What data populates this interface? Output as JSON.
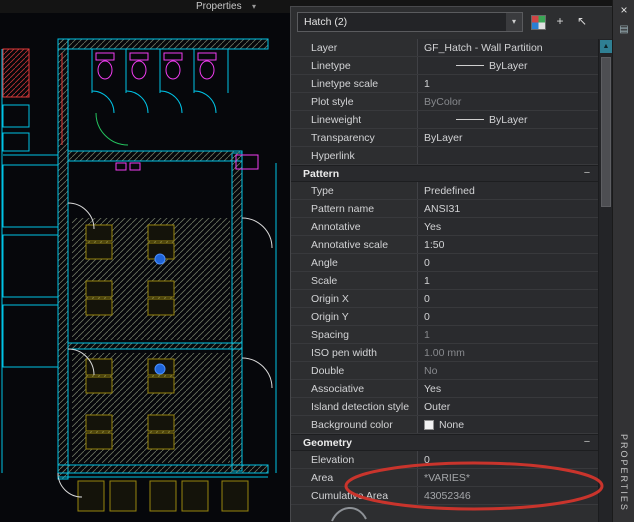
{
  "topbar": {
    "title": "Properties",
    "caret": "▾"
  },
  "panel": {
    "selector": {
      "value": "Hatch (2)",
      "caret": "▾"
    },
    "header_icons": {
      "quick_select": "quick-select",
      "pickadd": "+",
      "select_objects": "↖"
    },
    "side": {
      "close": "×",
      "autohide": "▤",
      "tab": "PROPERTIES"
    },
    "scrollbar": {
      "up": "▲"
    },
    "general": {
      "rows": [
        {
          "label": "Layer",
          "value": "GF_Hatch - Wall Partition"
        },
        {
          "label": "Linetype",
          "value": "ByLayer"
        },
        {
          "label": "Linetype scale",
          "value": "1"
        },
        {
          "label": "Plot style",
          "value": "ByColor"
        },
        {
          "label": "Lineweight",
          "value": "ByLayer"
        },
        {
          "label": "Transparency",
          "value": "ByLayer"
        },
        {
          "label": "Hyperlink",
          "value": ""
        }
      ]
    },
    "pattern": {
      "title": "Pattern",
      "collapse": "−",
      "rows": [
        {
          "label": "Type",
          "value": "Predefined"
        },
        {
          "label": "Pattern name",
          "value": "ANSI31"
        },
        {
          "label": "Annotative",
          "value": "Yes"
        },
        {
          "label": "Annotative scale",
          "value": "1:50"
        },
        {
          "label": "Angle",
          "value": "0"
        },
        {
          "label": "Scale",
          "value": "1"
        },
        {
          "label": "Origin X",
          "value": "0"
        },
        {
          "label": "Origin Y",
          "value": "0"
        },
        {
          "label": "Spacing",
          "value": "1"
        },
        {
          "label": "ISO pen width",
          "value": "1.00 mm"
        },
        {
          "label": "Double",
          "value": "No"
        },
        {
          "label": "Associative",
          "value": "Yes"
        },
        {
          "label": "Island detection style",
          "value": "Outer"
        },
        {
          "label": "Background color",
          "value": "None"
        }
      ]
    },
    "geometry": {
      "title": "Geometry",
      "collapse": "−",
      "rows": [
        {
          "label": "Elevation",
          "value": "0"
        },
        {
          "label": "Area",
          "value": "*VARIES*"
        },
        {
          "label": "Cumulative Area",
          "value": "43052346"
        }
      ]
    }
  },
  "annotation": {
    "color": "#c9342c"
  }
}
